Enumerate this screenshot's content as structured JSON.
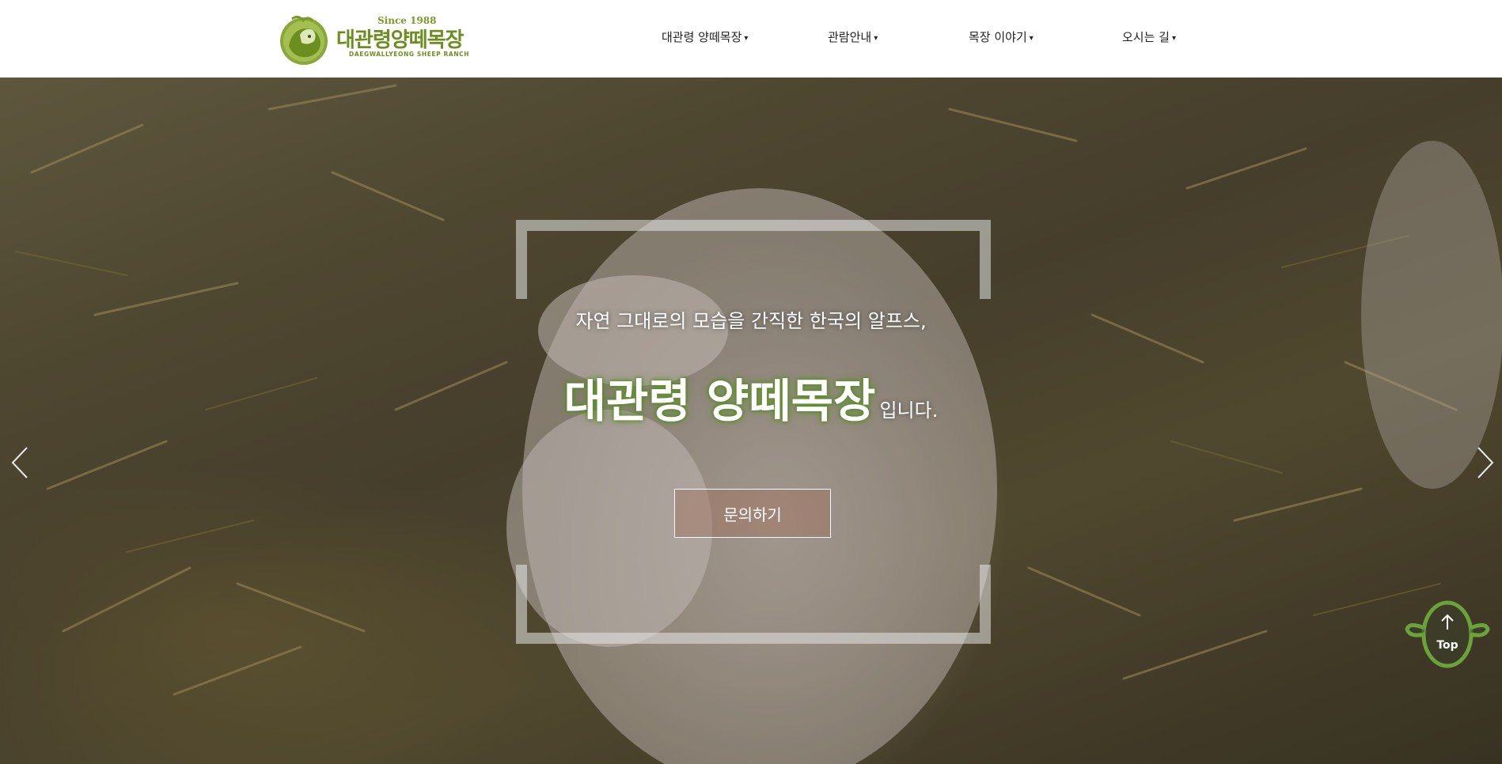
{
  "header": {
    "logo": {
      "since": "Since 1988",
      "title": "대관령양떼목장",
      "subtitle": "DAEGWALLYEONG SHEEP RANCH"
    },
    "nav": [
      {
        "label": "대관령 양떼목장"
      },
      {
        "label": "관람안내"
      },
      {
        "label": "목장 이야기"
      },
      {
        "label": "오시는 길"
      }
    ],
    "dropdown_glyph": "▾"
  },
  "hero": {
    "line1": "자연 그대로의 모습을 간직한 한국의 알프스,",
    "title": "대관령 양떼목장",
    "suffix": "입니다.",
    "cta_label": "문의하기"
  },
  "top_button": {
    "label": "Top"
  },
  "colors": {
    "brand_green": "#6b8e1e",
    "top_button_green": "#6aa33a"
  },
  "icons": {
    "prev": "chevron-left-icon",
    "next": "chevron-right-icon",
    "top": "arrow-up-icon"
  }
}
